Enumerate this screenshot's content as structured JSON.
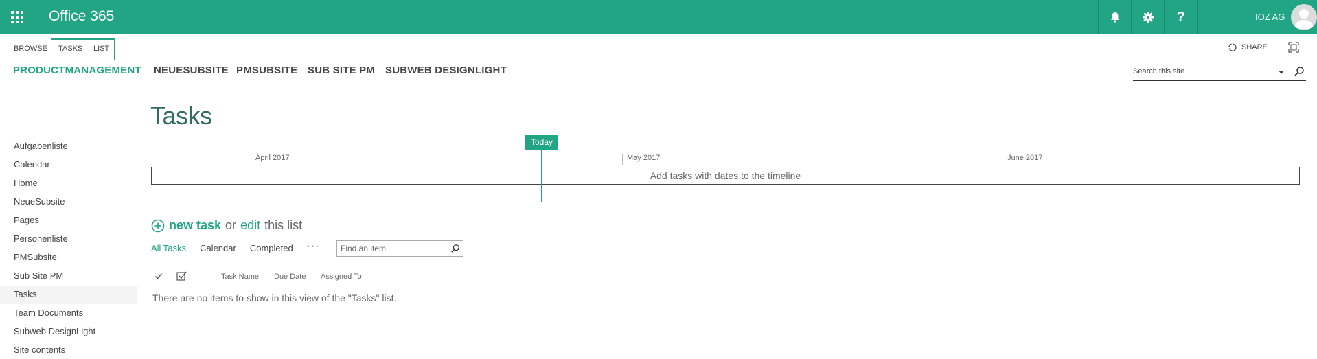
{
  "suitebar": {
    "brand": "Office 365",
    "user_name": "IOZ AG",
    "help_label": "?",
    "icons": [
      "app-launcher-icon",
      "bell-icon",
      "gear-icon",
      "help-icon",
      "avatar-icon"
    ]
  },
  "ribbon": {
    "tabs": [
      {
        "label": "BROWSE"
      },
      {
        "label": "TASKS"
      },
      {
        "label": "LIST"
      }
    ],
    "share_label": "SHARE"
  },
  "topnav": {
    "items": [
      {
        "label": "PRODUCTMANAGEMENT",
        "active": true
      },
      {
        "label": "NEUESUBSITE"
      },
      {
        "label": "PMSUBSITE"
      },
      {
        "label": "SUB SITE PM"
      },
      {
        "label": "SUBWEB DESIGNLIGHT"
      }
    ],
    "search_placeholder": "Search this site"
  },
  "quicklaunch": {
    "items": [
      {
        "label": "Aufgabenliste"
      },
      {
        "label": "Calendar"
      },
      {
        "label": "Home"
      },
      {
        "label": "NeueSubsite"
      },
      {
        "label": "Pages"
      },
      {
        "label": "Personenliste"
      },
      {
        "label": "PMSubsite"
      },
      {
        "label": "Sub Site PM"
      },
      {
        "label": "Tasks",
        "selected": true
      },
      {
        "label": "Team Documents"
      },
      {
        "label": "Subweb DesignLight"
      },
      {
        "label": "Site contents"
      }
    ]
  },
  "main": {
    "title": "Tasks",
    "timeline": {
      "today_label": "Today",
      "months": [
        "April 2017",
        "May 2017",
        "June 2017"
      ],
      "empty_text": "Add tasks with dates to the timeline"
    },
    "new_task": {
      "new_label": "new task",
      "or_label": "or",
      "edit_label": "edit",
      "this_list_label": "this list"
    },
    "views": [
      {
        "label": "All Tasks",
        "active": true
      },
      {
        "label": "Calendar"
      },
      {
        "label": "Completed"
      }
    ],
    "more_label": "···",
    "find_placeholder": "Find an item",
    "columns": [
      "Task Name",
      "Due Date",
      "Assigned To"
    ],
    "empty_message": "There are no items to show in this view of the \"Tasks\" list."
  },
  "colors": {
    "accent": "#21a584",
    "title": "#2f6b5e"
  }
}
